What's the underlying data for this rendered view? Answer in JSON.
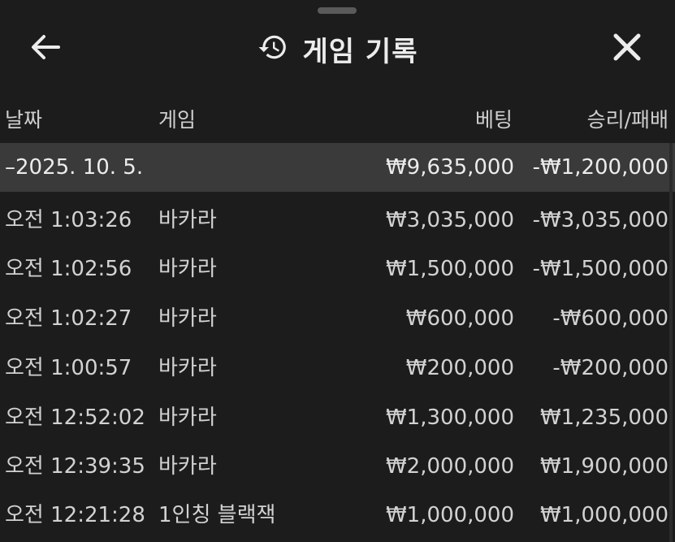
{
  "header": {
    "title": "게임 기록",
    "back_icon": "arrow-left-icon",
    "history_icon": "history-clock-icon",
    "close_icon": "close-icon"
  },
  "columns": {
    "date": "날짜",
    "game": "게임",
    "bet": "베팅",
    "result": "승리/패배"
  },
  "summary": {
    "date": "–2025. 10. 5.",
    "bet": "₩9,635,000",
    "result": "-₩1,200,000"
  },
  "rows": [
    {
      "time": "오전 1:03:26",
      "game": "바카라",
      "bet": "₩3,035,000",
      "result": "-₩3,035,000"
    },
    {
      "time": "오전 1:02:56",
      "game": "바카라",
      "bet": "₩1,500,000",
      "result": "-₩1,500,000"
    },
    {
      "time": "오전 1:02:27",
      "game": "바카라",
      "bet": "₩600,000",
      "result": "-₩600,000"
    },
    {
      "time": "오전 1:00:57",
      "game": "바카라",
      "bet": "₩200,000",
      "result": "-₩200,000"
    },
    {
      "time": "오전 12:52:02",
      "game": "바카라",
      "bet": "₩1,300,000",
      "result": "₩1,235,000"
    },
    {
      "time": "오전 12:39:35",
      "game": "바카라",
      "bet": "₩2,000,000",
      "result": "₩1,900,000"
    },
    {
      "time": "오전 12:21:28",
      "game": "1인칭 블랙잭",
      "bet": "₩1,000,000",
      "result": "₩1,000,000"
    }
  ],
  "colors": {
    "background": "#1c1c1c",
    "summary_row": "#3a3a3a",
    "text": "#d2d2d2"
  }
}
